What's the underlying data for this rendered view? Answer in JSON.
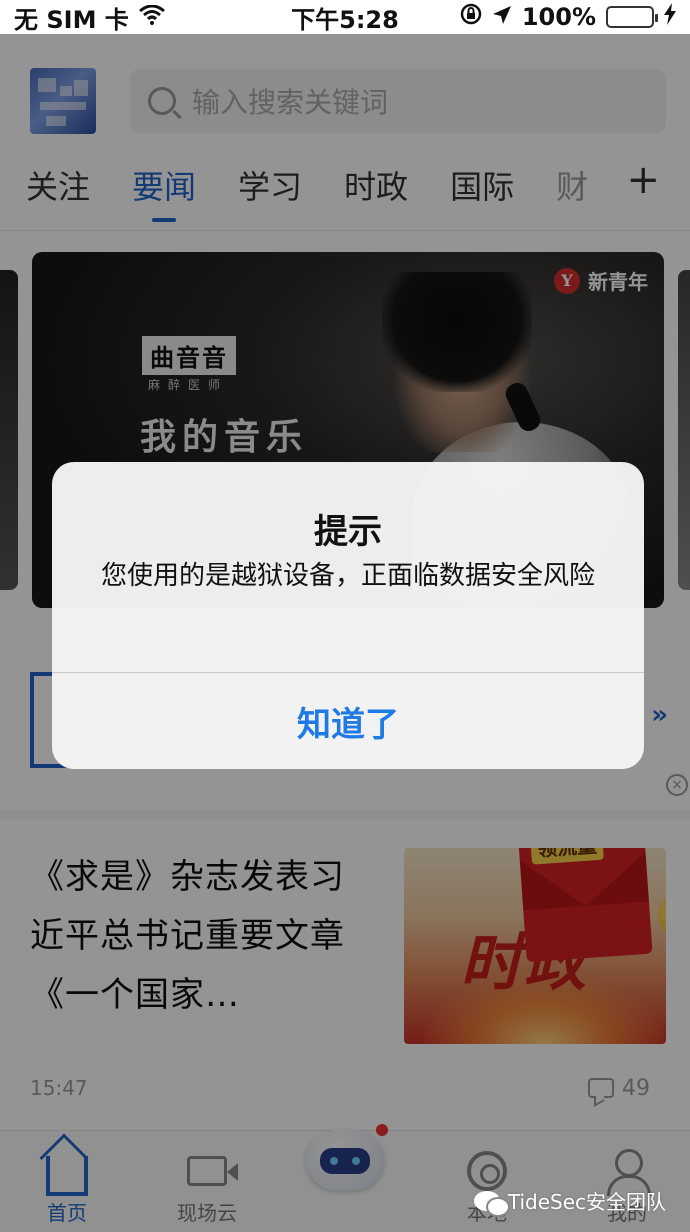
{
  "status_bar": {
    "carrier": "无 SIM 卡",
    "time": "下午5:28",
    "battery": "100%"
  },
  "header": {
    "search_placeholder": "输入搜索关键词"
  },
  "tabs": [
    {
      "label": "关注"
    },
    {
      "label": "要闻"
    },
    {
      "label": "学习"
    },
    {
      "label": "时政"
    },
    {
      "label": "国际"
    },
    {
      "label": "财"
    }
  ],
  "tab_plus": "+",
  "banner": {
    "brand": "新青年",
    "tag": "曲音音",
    "sub": "麻醉医师",
    "title": "我的音乐"
  },
  "section2": {
    "more": "»"
  },
  "news": {
    "title": "《求是》杂志发表习近平总书记重要文章《一个国家…",
    "time": "15:47",
    "comments": "49",
    "thumb_label": "领流量",
    "thumb_text": "时政"
  },
  "tabbar": {
    "home": "首页",
    "live": "现场云",
    "local": "本地",
    "mine": "我的"
  },
  "alert": {
    "title": "提示",
    "message": "您使用的是越狱设备，正面临数据安全风险",
    "button": "知道了"
  },
  "watermark": "TideSec安全团队",
  "colors": {
    "accent": "#2164c9",
    "alert_button": "#1f7ae6",
    "battery": "#3fc144"
  }
}
